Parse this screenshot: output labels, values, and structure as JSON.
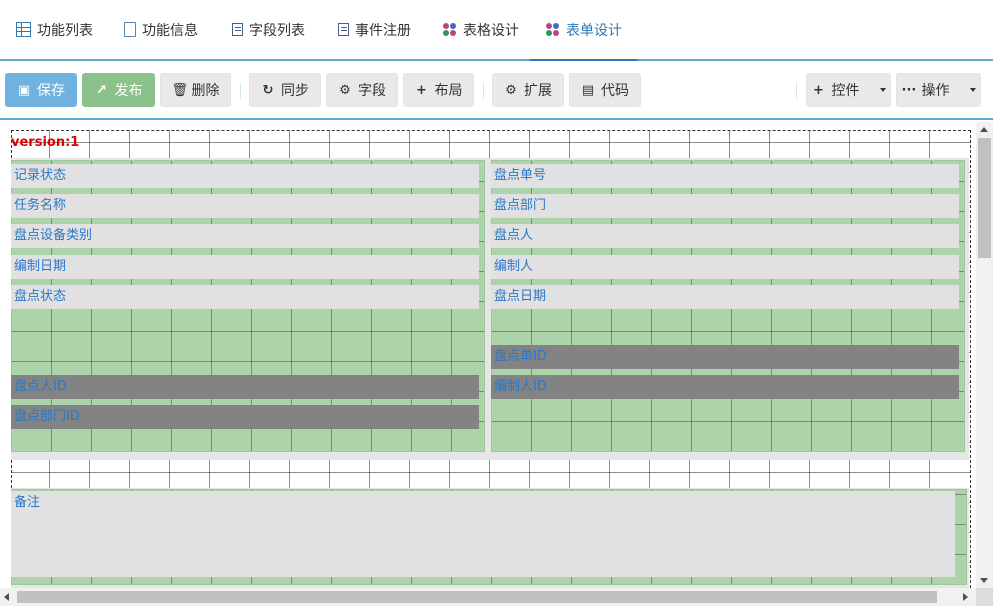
{
  "tabs": [
    {
      "label": "功能列表",
      "icon": "grid-icon"
    },
    {
      "label": "功能信息",
      "icon": "file-icon"
    },
    {
      "label": "字段列表",
      "icon": "list-icon"
    },
    {
      "label": "事件注册",
      "icon": "list-icon"
    },
    {
      "label": "表格设计",
      "icon": "dots-icon"
    },
    {
      "label": "表单设计",
      "icon": "dots-icon",
      "active": true
    }
  ],
  "toolbar": {
    "save": "保存",
    "publish": "发布",
    "delete": "删除",
    "sync": "同步",
    "field": "字段",
    "layout": "布局",
    "extend": "扩展",
    "code": "代码",
    "controls": "控件",
    "actions": "操作"
  },
  "canvas": {
    "version": "version:1",
    "left_fields": [
      "记录状态",
      "任务名称",
      "盘点设备类别",
      "编制日期",
      "盘点状态"
    ],
    "right_fields": [
      "盘点单号",
      "盘点部门",
      "盘点人",
      "编制人",
      "盘点日期"
    ],
    "hidden_fields": {
      "right_1": "盘点单ID",
      "left_1": "盘点人ID",
      "right_2": "编制人ID",
      "left_2": "盘点部门ID"
    },
    "remark": "备注"
  },
  "colors": {
    "accent": "#2e77b6",
    "zone": "#a9d3a6",
    "field": "#e1e1e1",
    "hidden_field": "#838383",
    "field_text": "#2a77c9",
    "version": "#e00000"
  }
}
